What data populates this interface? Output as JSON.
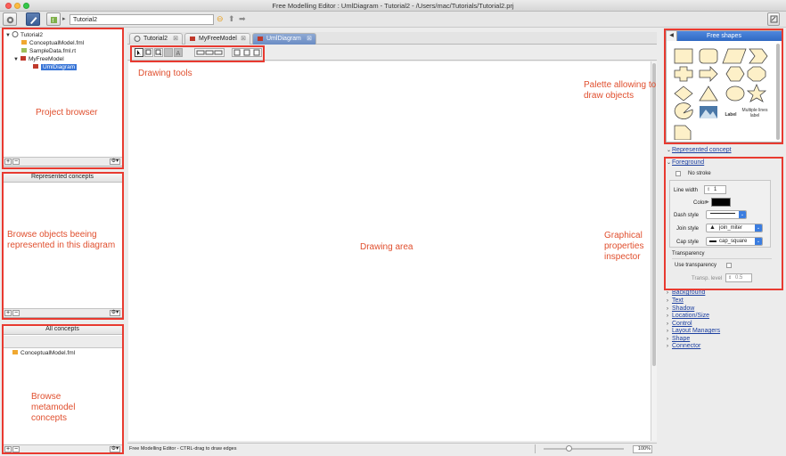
{
  "window": {
    "title": "Free Modelling Editor : UmlDiagram - Tutorial2 - /Users/mac/Tutorials/Tutorial2.prj"
  },
  "toolbar": {
    "path_value": "Tutorial2"
  },
  "project_browser": {
    "items": [
      {
        "label": "Tutorial2",
        "icon": "project-icon"
      },
      {
        "label": "ConceptualModel.fml",
        "icon": "fml-file-icon"
      },
      {
        "label": "SampleData.fml.rt",
        "icon": "rt-file-icon"
      },
      {
        "label": "MyFreeModel",
        "icon": "model-icon"
      },
      {
        "label": "UmlDiagram",
        "icon": "diagram-icon"
      }
    ]
  },
  "represented_concepts": {
    "title": "Represented concepts"
  },
  "all_concepts": {
    "title": "All concepts",
    "items": [
      {
        "label": "ConceptualModel.fml"
      }
    ]
  },
  "editor": {
    "tabs": [
      {
        "label": "Tutorial2"
      },
      {
        "label": "MyFreeModel"
      },
      {
        "label": "UmlDiagram"
      }
    ],
    "status_text": "Free Modelling Editor - CTRL-drag to draw edges",
    "zoom": "100%",
    "zoom_fraction": 0.32
  },
  "palette": {
    "title": "Free shapes",
    "label_item": "Label",
    "multiline_item": "Multiple lines label"
  },
  "inspector": {
    "represented_concept": "Represented concept",
    "foreground": "Foreground",
    "no_stroke": "No stroke",
    "line_width_label": "Line width",
    "line_width_value": "1",
    "color_label": "Color",
    "dash_style_label": "Dash style",
    "join_style_label": "Join style",
    "join_style_value": "join_miter",
    "cap_style_label": "Cap style",
    "cap_style_value": "cap_square",
    "transparency_label": "Transparency",
    "use_transparency": "Use transparency",
    "transp_level_label": "Transp. level",
    "transp_level_value": "0.5",
    "sections": [
      "Background",
      "Text",
      "Shadow",
      "Location/Size",
      "Control",
      "Layout Managers",
      "Shape",
      "Connector"
    ]
  },
  "annotations": {
    "project_browser": "Project browser",
    "drawing_tools": "Drawing tools",
    "palette": "Palette allowing to draw objects",
    "browse_objects": "Browse objects beeing represented in this diagram",
    "drawing_area": "Drawing area",
    "graphical_inspector": "Graphical properties inspector",
    "browse_metamodel": "Browse metamodel concepts"
  },
  "colors": {
    "annotation": "#e83a30",
    "selection": "#3875d7",
    "palette_header": "#2f69c3"
  }
}
